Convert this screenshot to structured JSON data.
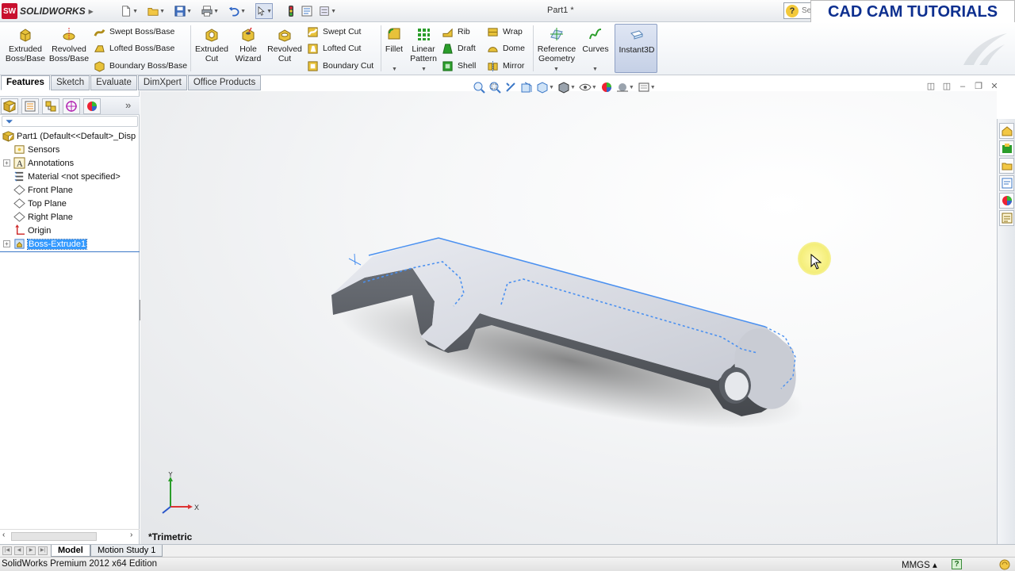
{
  "app": {
    "name": "SOLIDWORKS",
    "document_title": "Part1 *",
    "search_placeholder": "Se",
    "overlay_banner": "CAD CAM TUTORIALS"
  },
  "ribbon": {
    "extruded_boss": "Extruded Boss/Base",
    "revolved_boss": "Revolved Boss/Base",
    "swept_boss": "Swept Boss/Base",
    "lofted_boss": "Lofted Boss/Base",
    "boundary_boss": "Boundary Boss/Base",
    "extruded_cut": "Extruded Cut",
    "hole_wizard": "Hole Wizard",
    "revolved_cut": "Revolved Cut",
    "swept_cut": "Swept Cut",
    "lofted_cut": "Lofted Cut",
    "boundary_cut": "Boundary Cut",
    "fillet": "Fillet",
    "linear_pattern": "Linear Pattern",
    "rib": "Rib",
    "draft": "Draft",
    "shell": "Shell",
    "wrap": "Wrap",
    "dome": "Dome",
    "mirror": "Mirror",
    "reference_geometry": "Reference Geometry",
    "curves": "Curves",
    "instant3d": "Instant3D"
  },
  "command_tabs": [
    "Features",
    "Sketch",
    "Evaluate",
    "DimXpert",
    "Office Products"
  ],
  "feature_tree": {
    "part": "Part1  (Default<<Default>_Disp",
    "items": [
      {
        "label": "Sensors",
        "icon": "sensors-icon",
        "expandable": false
      },
      {
        "label": "Annotations",
        "icon": "annotations-icon",
        "expandable": true
      },
      {
        "label": "Material <not specified>",
        "icon": "material-icon",
        "expandable": false
      },
      {
        "label": "Front Plane",
        "icon": "plane-icon",
        "expandable": false
      },
      {
        "label": "Top Plane",
        "icon": "plane-icon",
        "expandable": false
      },
      {
        "label": "Right Plane",
        "icon": "plane-icon",
        "expandable": false
      },
      {
        "label": "Origin",
        "icon": "origin-icon",
        "expandable": false
      },
      {
        "label": "Boss-Extrude1",
        "icon": "boss-extrude-icon",
        "expandable": true,
        "selected": true
      }
    ]
  },
  "viewport": {
    "view_orientation": "*Trimetric",
    "triad_axes": [
      "Y",
      "X"
    ]
  },
  "bottom_tabs": [
    "Model",
    "Motion Study 1"
  ],
  "status_bar": {
    "edition": "SolidWorks Premium 2012 x64 Edition",
    "units": "MMGS"
  },
  "colors": {
    "selection_blue": "#3399ff",
    "model_grey": "#5f6369",
    "brand_red": "#c8102e"
  }
}
